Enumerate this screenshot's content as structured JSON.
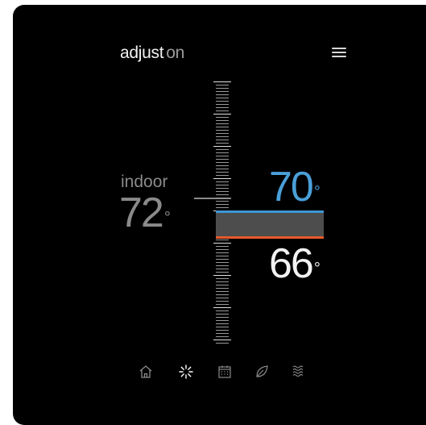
{
  "header": {
    "title": "adjust",
    "state": "on"
  },
  "indoor": {
    "label": "indoor",
    "value": "72",
    "unit": "°"
  },
  "setpoints": {
    "cool": {
      "value": "70",
      "unit": "°",
      "color": "#3d97d6"
    },
    "heat": {
      "value": "66",
      "unit": "°",
      "color": "#e65a2b"
    }
  },
  "nav": {
    "items": [
      {
        "icon": "home-icon"
      },
      {
        "icon": "sun-icon",
        "active": true
      },
      {
        "icon": "calendar-icon"
      },
      {
        "icon": "leaf-icon"
      },
      {
        "icon": "waves-icon"
      }
    ]
  },
  "colors": {
    "background": "#000000",
    "cool": "#3d97d6",
    "heat": "#e65a2b",
    "band": "#4d4d4d"
  }
}
